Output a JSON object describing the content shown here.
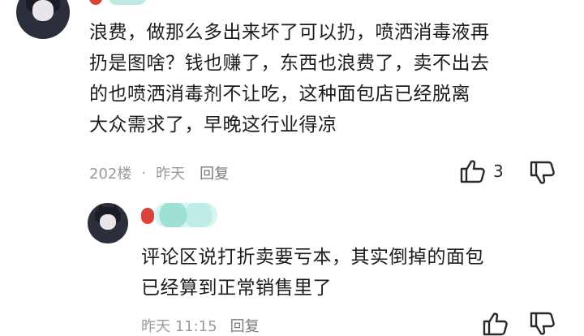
{
  "comments": [
    {
      "text_lines": [
        "浪费，做那么多出来坏了可以扔，喷洒消毒液再",
        "扔是图啥？钱也赚了，东西也浪费了，卖不出去",
        "的也喷洒消毒剂不让吃，这种面包店已经脱离",
        "大众需求了，早晚这行业得凉"
      ],
      "floor": "202楼",
      "separator": "·",
      "time": "昨天",
      "reply_label": "回复",
      "like_count": "3"
    },
    {
      "text_lines": [
        "评论区说打折卖要亏本，其实倒掉的面包",
        "已经算到正常销售里了"
      ],
      "time": "昨天 11:15",
      "reply_label": "回复"
    }
  ],
  "icons": {
    "like": "thumbs-up-icon",
    "dislike": "thumbs-down-icon"
  },
  "colors": {
    "text": "#1c1c1c",
    "meta": "#9a9a9a",
    "badge_red": "#d9443a",
    "badge_teal": "#7fd3c4"
  }
}
